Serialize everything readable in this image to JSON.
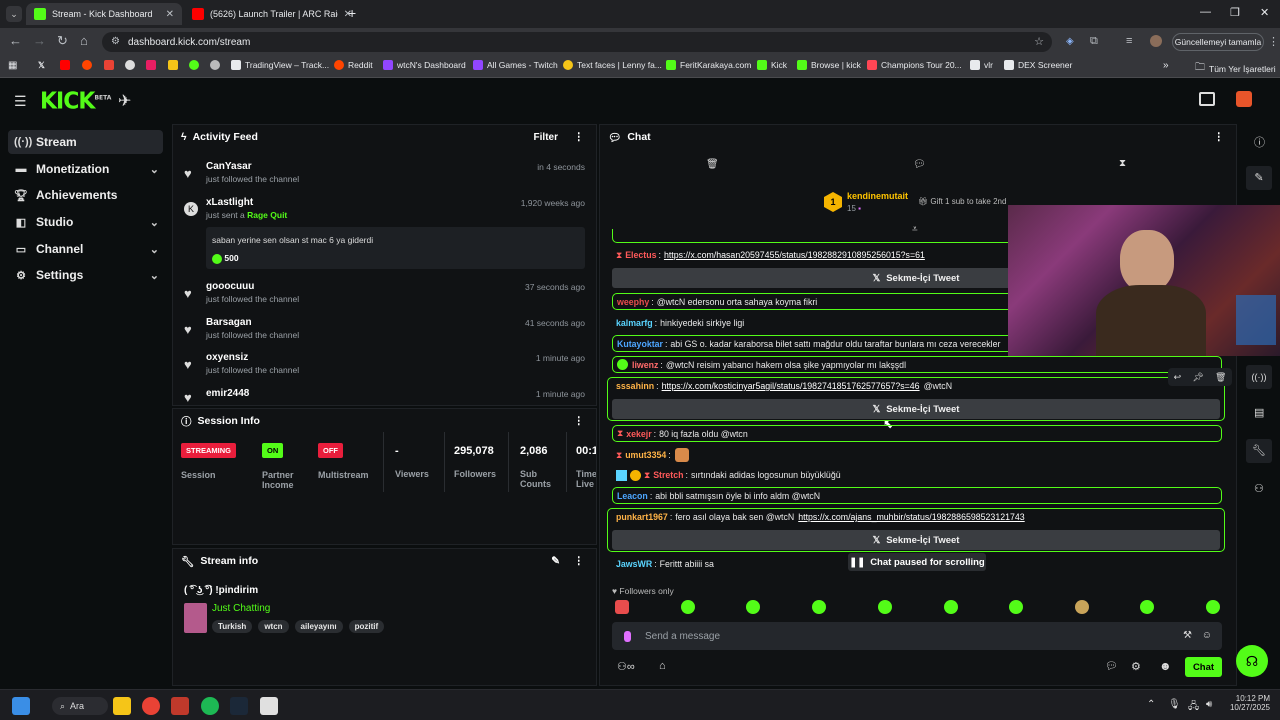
{
  "browser": {
    "tabs": [
      {
        "title": "Stream - Kick Dashboard",
        "favicon_color": "#53fc18"
      },
      {
        "title": "(5626) Launch Trailer | ARC Raid",
        "favicon_color": "#ff0000"
      }
    ],
    "url": "dashboard.kick.com/stream",
    "update_button": "Güncellemeyi tamamla",
    "bookmarks": [
      {
        "label": "TradingView – Track...",
        "color": "#e8eaed"
      },
      {
        "label": "Reddit",
        "color": "#ff4500"
      },
      {
        "label": "wtcN's Dashboard",
        "color": "#9146ff"
      },
      {
        "label": "All Games - Twitch",
        "color": "#9146ff"
      },
      {
        "label": "Text faces | Lenny fa...",
        "color": "#f5c518"
      },
      {
        "label": "FeritKarakaya.com",
        "color": "#53fc18"
      },
      {
        "label": "Kick",
        "color": "#53fc18"
      },
      {
        "label": "Browse | kick",
        "color": "#53fc18"
      },
      {
        "label": "Champions Tour 20...",
        "color": "#ff4655"
      },
      {
        "label": "vlr",
        "color": "#e8eaed"
      },
      {
        "label": "DEX Screener",
        "color": "#e8eaed"
      }
    ],
    "all_bookmarks": "Tüm Yer İşaretleri"
  },
  "kick": {
    "logo": "KICK",
    "logo_sup": "BETA",
    "accent": "#53fc18"
  },
  "sidebar": {
    "items": [
      {
        "label": "Stream",
        "icon": "broadcast-icon"
      },
      {
        "label": "Monetization",
        "icon": "money-icon"
      },
      {
        "label": "Achievements",
        "icon": "trophy-icon"
      },
      {
        "label": "Studio",
        "icon": "studio-icon"
      },
      {
        "label": "Channel",
        "icon": "channel-icon"
      },
      {
        "label": "Settings",
        "icon": "gear-icon"
      }
    ]
  },
  "activity": {
    "title": "Activity Feed",
    "filter": "Filter",
    "items": [
      {
        "name": "CanYasar",
        "action": "just followed the channel",
        "time": "in 4 seconds"
      },
      {
        "name": "xLastlight",
        "action": "just sent a",
        "highlight": "Rage Quit",
        "time": "1,920 weeks ago",
        "message": "saban yerine sen olsan st mac 6 ya giderdi",
        "amount": "500"
      },
      {
        "name": "gooocuuu",
        "action": "just followed the channel",
        "time": "37 seconds ago"
      },
      {
        "name": "Barsagan",
        "action": "just followed the channel",
        "time": "41 seconds ago"
      },
      {
        "name": "oxyensiz",
        "action": "just followed the channel",
        "time": "1 minute ago"
      },
      {
        "name": "emir2448",
        "action": "",
        "time": "1 minute ago"
      }
    ]
  },
  "session": {
    "title": "Session Info",
    "stats": [
      {
        "value": "STREAMING",
        "label": "Session",
        "badge_color": "#e91e3c"
      },
      {
        "value": "ON",
        "label": "Partner Income",
        "badge_color": "#53fc18"
      },
      {
        "value": "OFF",
        "label": "Multistream",
        "badge_color": "#e91e3c"
      },
      {
        "value": "-",
        "label": "Viewers"
      },
      {
        "value": "295,078",
        "label": "Followers"
      },
      {
        "value": "2,086",
        "label": "Sub Counts"
      },
      {
        "value": "00:1",
        "label": "Time Live"
      }
    ]
  },
  "stream_info": {
    "title": "Stream info",
    "stream_title": "( ͡° ͜ʖ ͡°) !pindirim",
    "category": "Just Chatting",
    "tags": [
      "Turkish",
      "wtcn",
      "aileyayını",
      "pozitif"
    ]
  },
  "chat": {
    "title": "Chat",
    "top_gifter": {
      "name": "kendinemutait",
      "rank": "1",
      "count": "15"
    },
    "gift_prompt": "Gift 1 sub to take 2nd",
    "tweet_button": "Sekme-İçi Tweet",
    "messages": [
      {
        "user": "Electus",
        "color": "#ff5a5a",
        "text": "",
        "link": "https://x.com/hasan20597455/status/1982882910895256015?s=61"
      },
      {
        "user": "weephy",
        "color": "#e84d4d",
        "text": "@wtcN edersonu orta sahaya koyma fikri",
        "link": ""
      },
      {
        "user": "kalmarfg",
        "color": "#5ad4ff",
        "text": "hinkiyedeki sirkiye ligi",
        "link": ""
      },
      {
        "user": "Kutayoktar",
        "color": "#4da6ff",
        "text": "abi GS o. kadar karaborsa bilet sattı mağdur oldu taraftar bunlara mı ceza verecekler",
        "link": ""
      },
      {
        "user": "liwenz",
        "color": "#ff6b6b",
        "text": "@wtcN reisim yabancı hakem olsa şike yapmıyolar mı lakşşdl",
        "link": ""
      },
      {
        "user": "sssahinn",
        "color": "#ffb347",
        "text": "@wtcN",
        "link": "https://x.com/kosticinyar5agil/status/1982741851762577657?s=46"
      },
      {
        "user": "xekejr",
        "color": "#ff5a5a",
        "text": "80 iq fazla oldu @wtcn",
        "link": ""
      },
      {
        "user": "umut3354",
        "color": "#ffb347",
        "text": "",
        "link": ""
      },
      {
        "user": "Stretch",
        "color": "#ff5a5a",
        "text": "sırtındaki adidas logosunun büyüklüğü",
        "link": ""
      },
      {
        "user": "Leacon",
        "color": "#4da6ff",
        "text": "abi bbli satmışsın öyle bi info aldm @wtcN",
        "link": ""
      },
      {
        "user": "punkart1967",
        "color": "#ffb347",
        "text": "fero asıl olaya bak sen @wtcN",
        "link": "https://x.com/ajans_muhbir/status/1982886598523121743"
      },
      {
        "user": "JawsWR",
        "color": "#5ad4ff",
        "text": "Ferittt abiiii sa",
        "link": ""
      }
    ],
    "paused": "Chat paused for scrolling",
    "followers_only": "Followers only",
    "placeholder": "Send a message",
    "send_button": "Chat"
  },
  "taskbar": {
    "search": "Ara",
    "time": "10:12 PM",
    "date": "10/27/2025"
  }
}
